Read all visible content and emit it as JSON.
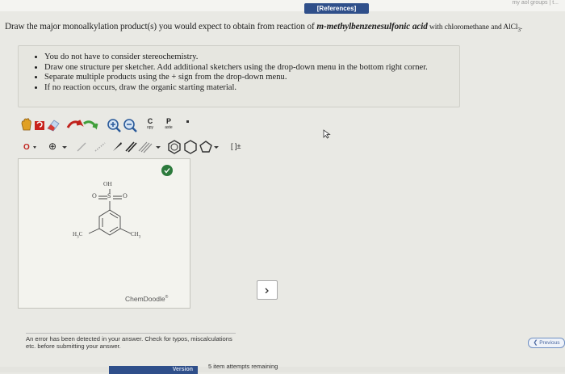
{
  "header": {
    "references_label": "[References]",
    "corner_text": "my aol groups | t..."
  },
  "question": {
    "prefix": "Draw the major monoalkylation product(s) you would expect to obtain from reaction of ",
    "reactant": "m-methylbenzenesulfonic acid",
    "suffix": " with chloromethane and AlCl",
    "subscript": "3",
    "end": "."
  },
  "instructions": [
    "You do not have to consider stereochemistry.",
    "Draw one structure per sketcher. Add additional sketchers using the drop-down menu in the bottom right corner.",
    "Separate multiple products using the + sign from the drop-down menu.",
    "If no reaction occurs, draw the organic starting material."
  ],
  "toolbar": {
    "copy_label": "C",
    "copy_sub": "opy",
    "paste_label": "P",
    "paste_sub": "aste",
    "charge_plus": "⊕",
    "bracket_label": "[ ]±"
  },
  "molecule": {
    "oh": "OH",
    "o_left": "O",
    "s": "S",
    "o_right": "O",
    "h3c": "H",
    "h3c_sub": "3",
    "h3c_c": "C",
    "ch3": "CH",
    "ch3_sub": "3"
  },
  "sketcher": {
    "brand": "ChemDoodle",
    "reg": "®"
  },
  "dropdown_icon": "chevron-down-icon",
  "error_message": "An error has been detected in your answer. Check for typos, miscalculations etc. before submitting your answer.",
  "previous_label": "Previous",
  "submit_label": "Version",
  "attempts_text": "5 item attempts remaining"
}
